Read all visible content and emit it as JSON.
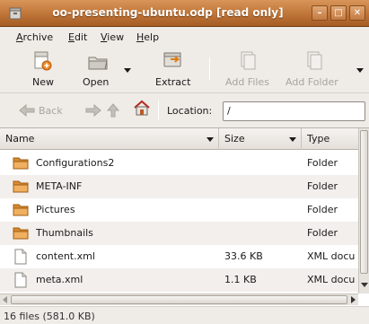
{
  "window": {
    "title": "oo-presenting-ubuntu.odp [read only]",
    "minimize_glyph": "–",
    "maximize_glyph": "□",
    "close_glyph": "✕"
  },
  "menu": [
    {
      "label_mn": "A",
      "label_rest": "rchive"
    },
    {
      "label_mn": "E",
      "label_rest": "dit"
    },
    {
      "label_mn": "V",
      "label_rest": "iew"
    },
    {
      "label_mn": "H",
      "label_rest": "elp"
    }
  ],
  "toolbar": {
    "new_label": "New",
    "open_label": "Open",
    "extract_label": "Extract",
    "add_files_label": "Add Files",
    "add_folder_label": "Add Folder"
  },
  "location_bar": {
    "back_label": "Back",
    "location_label": "Location:",
    "location_value": "/"
  },
  "columns": {
    "name": "Name",
    "size": "Size",
    "type": "Type"
  },
  "files": [
    {
      "name": "Configurations2",
      "size": "",
      "type": "Folder",
      "icon": "folder-icon"
    },
    {
      "name": "META-INF",
      "size": "",
      "type": "Folder",
      "icon": "folder-icon"
    },
    {
      "name": "Pictures",
      "size": "",
      "type": "Folder",
      "icon": "folder-icon"
    },
    {
      "name": "Thumbnails",
      "size": "",
      "type": "Folder",
      "icon": "folder-icon"
    },
    {
      "name": "content.xml",
      "size": "33.6 KB",
      "type": "XML docu",
      "icon": "document-icon"
    },
    {
      "name": "meta.xml",
      "size": "1.1 KB",
      "type": "XML docu",
      "icon": "document-icon"
    }
  ],
  "status": {
    "text": "16 files (581.0 KB)"
  },
  "colors": {
    "titlebar": "#c47a3d",
    "folder": "#e8a14a",
    "window_bg": "#efebe7"
  }
}
